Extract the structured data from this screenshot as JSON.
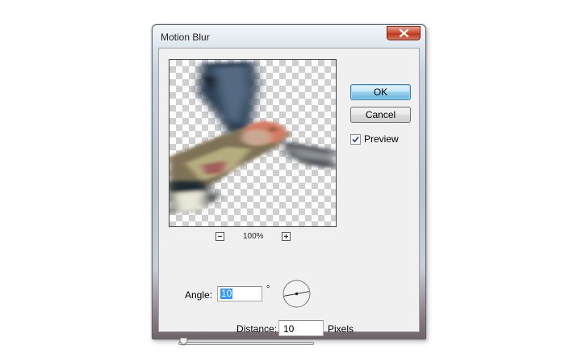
{
  "dialog": {
    "title": "Motion Blur",
    "ok_label": "OK",
    "cancel_label": "Cancel",
    "preview_label": "Preview",
    "preview_checked": true,
    "zoom_level": "100%",
    "angle_label": "Angle:",
    "angle_value": "10",
    "angle_unit": "°",
    "distance_label": "Distance:",
    "distance_value": "10",
    "distance_unit": "Pixels"
  },
  "icons": {
    "close": "close-icon",
    "zoom_out": "minus-icon",
    "zoom_in": "plus-icon",
    "check": "checkmark-icon",
    "angle_dial": "angle-dial-icon",
    "slider_thumb": "slider-thumb-icon"
  },
  "colors": {
    "default_button": "#98d1ef",
    "close_button": "#c03519",
    "selection": "#3399ff"
  }
}
